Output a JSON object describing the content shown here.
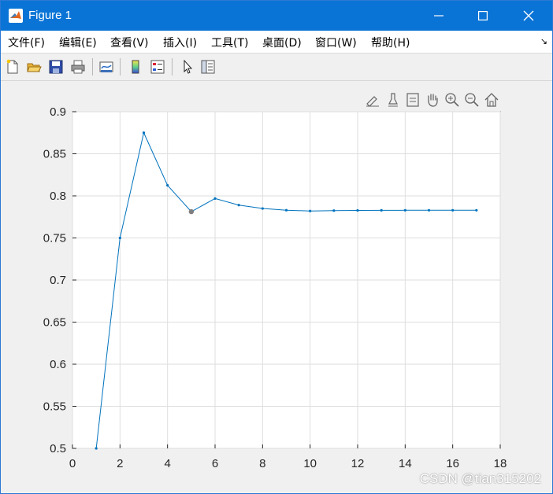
{
  "window": {
    "title": "Figure 1",
    "controls": [
      "minimize",
      "maximize",
      "close"
    ]
  },
  "menubar": {
    "items": [
      "文件(F)",
      "编辑(E)",
      "查看(V)",
      "插入(I)",
      "工具(T)",
      "桌面(D)",
      "窗口(W)",
      "帮助(H)"
    ]
  },
  "toolbar": {
    "buttons": [
      "new-figure-icon",
      "open-file-icon",
      "save-icon",
      "print-icon",
      "link-plot-icon",
      "colorbar-icon",
      "legend-icon",
      "pointer-icon",
      "property-inspector-icon"
    ]
  },
  "axes_toolbar": {
    "buttons": [
      "brush-edit-icon",
      "brush-data-icon",
      "datatip-icon",
      "pan-hand-icon",
      "zoom-in-icon",
      "zoom-out-icon",
      "home-icon"
    ]
  },
  "chart_data": {
    "type": "line",
    "x": [
      1,
      2,
      3,
      4,
      5,
      6,
      7,
      8,
      9,
      10,
      11,
      12,
      13,
      14,
      15,
      16,
      17
    ],
    "y": [
      0.5,
      0.75,
      0.875,
      0.8125,
      0.78125,
      0.796875,
      0.7890625,
      0.785,
      0.783,
      0.782,
      0.7825,
      0.7827,
      0.7828,
      0.7829,
      0.7829,
      0.7829,
      0.7829
    ],
    "xlim": [
      0,
      18
    ],
    "ylim": [
      0.5,
      0.9
    ],
    "xticks": [
      "0",
      "2",
      "4",
      "6",
      "8",
      "10",
      "12",
      "14",
      "16",
      "18"
    ],
    "yticks": [
      "0.5",
      "0.55",
      "0.6",
      "0.65",
      "0.7",
      "0.75",
      "0.8",
      "0.85",
      "0.9"
    ],
    "grid": true,
    "line_color": "#0072bd",
    "highlighted_point": {
      "x": 5,
      "y": 0.78125,
      "color": "#7f7f7f"
    }
  },
  "watermark": "CSDN @tian315202"
}
